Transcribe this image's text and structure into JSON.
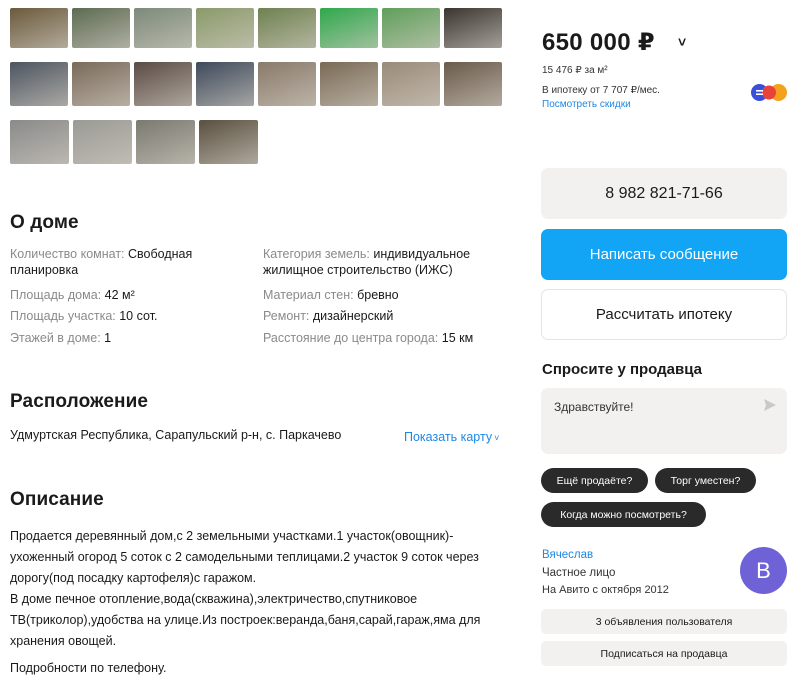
{
  "gallery": {
    "rows": [
      [
        "#6b5a3c",
        "#5d6b52",
        "#7c8a7a",
        "#8a9a6a",
        "#6f8150",
        "#2fa84b",
        "#5f9f5a",
        "#3a3530"
      ],
      [
        "#4d5560",
        "#7a6a5a",
        "#5a4b45",
        "#3e4a5c",
        "#8a7a6a",
        "#7a6a55",
        "#9a8a78",
        "#6a5a4a"
      ],
      [
        "#8a8a8a",
        "#9a9a95",
        "#7a7a70",
        "#5a5040"
      ]
    ]
  },
  "about": {
    "title": "О доме",
    "params": [
      {
        "key": "Количество комнат:",
        "value": "Свободная"
      },
      {
        "key": "",
        "value": "планировка"
      },
      {
        "key": "Площадь дома:",
        "value": "42 м²"
      },
      {
        "key": "Площадь участка:",
        "value": "10 сот."
      },
      {
        "key": "Этажей в доме:",
        "value": "1"
      },
      {
        "key": "Категория земель:",
        "value": "индивидуальное"
      },
      {
        "key": "",
        "value": "жилищное строительство (ИЖС)"
      },
      {
        "key": "Материал стен:",
        "value": "бревно"
      },
      {
        "key": "Ремонт:",
        "value": "дизайнерский"
      },
      {
        "key": "Расстояние до центра города:",
        "value": "15 км"
      }
    ]
  },
  "location": {
    "title": "Расположение",
    "address": "Удмуртская Республика, Сарапульский р-н, с. Паркачево",
    "map_link": "Показать карту",
    "map_chev": "˅"
  },
  "description": {
    "title": "Описание",
    "lines": [
      "Продается деревянный дом,с 2 земельными участками.1 участок(овощник)-",
      "ухоженный огород 5 соток с 2 самодельными теплицами.2 участок 9 соток через",
      "дорогу(под посадку картофеля)с гаражом.",
      "В доме печное отопление,вода(скважина),электричество,спутниковое",
      "ТВ(триколор),удобства на улице.Из построек:веранда,баня,сарай,гараж,яма для",
      "хранения овощей."
    ],
    "footer": "Подробности по телефону."
  },
  "sidebar": {
    "price": "650 000 ₽",
    "price_chev": "˅",
    "price_per_m": "15 476 ₽ за м²",
    "mortgage": "В ипотеку от 7 707 ₽/мес.",
    "discounts_link": "Посмотреть скидки",
    "phone": "8 982 821-71-66",
    "message_button": "Написать сообщение",
    "calc_button": "Рассчитать ипотеку",
    "ask_title": "Спросите у продавца",
    "ask_placeholder": "Здравствуйте!",
    "chips": [
      "Ещё продаёте?",
      "Торг уместен?",
      "Когда можно посмотреть?"
    ],
    "seller": {
      "name": "Вячеслав",
      "type": "Частное лицо",
      "since": "На Авито с октября 2012",
      "avatar_letter": "В",
      "avatar_color": "#6e62d6"
    },
    "user_ads_button": "3 объявления пользователя",
    "subscribe_button": "Подписаться на продавца"
  }
}
